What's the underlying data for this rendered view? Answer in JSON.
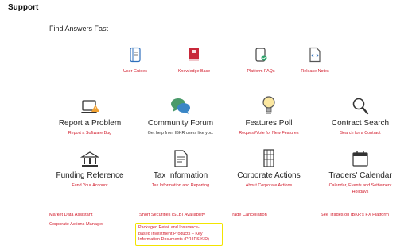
{
  "page_title": "Support",
  "section_title": "Find Answers Fast",
  "quick_links": [
    {
      "label": "User Guides",
      "icon": "book-icon"
    },
    {
      "label": "Knowledge Base",
      "icon": "knowledge-book-icon"
    },
    {
      "label": "Platform FAQs",
      "icon": "faq-device-icon"
    },
    {
      "label": "Release Notes",
      "icon": "code-document-icon"
    }
  ],
  "cards": [
    {
      "title": "Report a Problem",
      "sub": "Report a Software Bug",
      "icon": "laptop-warning-icon"
    },
    {
      "title": "Community Forum",
      "sub": "Get help from IBKR users like you.",
      "icon": "chat-bubbles-icon"
    },
    {
      "title": "Features Poll",
      "sub": "Request/Vote for New Features",
      "icon": "lightbulb-icon"
    },
    {
      "title": "Contract Search",
      "sub": "Search for a Contract",
      "icon": "magnifier-icon"
    },
    {
      "title": "Funding Reference",
      "sub": "Fund Your Account",
      "icon": "bank-card-icon"
    },
    {
      "title": "Tax Information",
      "sub": "Tax Information and Reporting",
      "icon": "tax-document-icon"
    },
    {
      "title": "Corporate Actions",
      "sub": "About Corporate Actions",
      "icon": "building-icon"
    },
    {
      "title": "Traders' Calendar",
      "sub": "Calendar, Events and Settlement Holidays",
      "icon": "calendar-icon"
    }
  ],
  "bottom_links": {
    "market_data_assistant": "Market Data Assistant",
    "corporate_actions_manager": "Corporate Actions Manager",
    "short_securities": "Short Securities (SLB) Availability",
    "trade_cancellation": "Trade Cancellation",
    "see_trades": "See Trades on IBKR's FX Platform",
    "priips_line1": "Packaged Retail and Insurance-",
    "priips_line2": "based Investment Products – Key",
    "priips_line3": "Information Documents (PRIIPS KID)"
  },
  "colors": {
    "accent": "#d11a2a",
    "highlight": "#f3e400",
    "title": "#222222"
  }
}
